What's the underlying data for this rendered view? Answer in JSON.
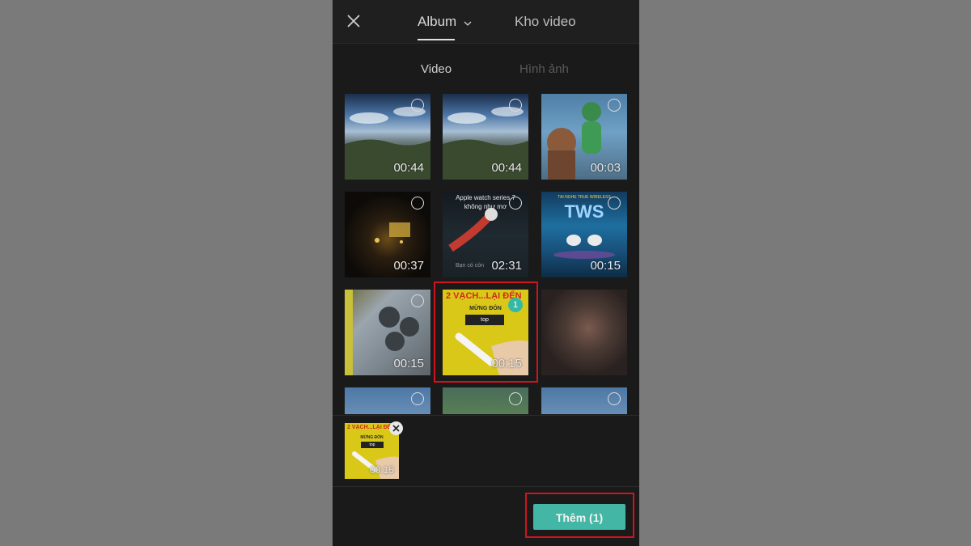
{
  "header": {
    "tabs": [
      {
        "label": "Album",
        "active": true
      },
      {
        "label": "Kho video",
        "active": false
      }
    ]
  },
  "subtabs": [
    {
      "label": "Video",
      "active": true
    },
    {
      "label": "Hình ảnh",
      "active": false
    }
  ],
  "grid": {
    "items": [
      {
        "duration": "00:44",
        "selected": false
      },
      {
        "duration": "00:44",
        "selected": false
      },
      {
        "duration": "00:03",
        "selected": false
      },
      {
        "duration": "00:37",
        "selected": false
      },
      {
        "duration": "02:31",
        "selected": false,
        "text_top": "Apple watch series 7",
        "text_mid": "không như mơ",
        "text_bottom": "Bạn có còn"
      },
      {
        "duration": "00:15",
        "selected": false,
        "text_top": "TAI NGHE TRUE WIRELESS",
        "logo": "TWS"
      },
      {
        "duration": "00:15",
        "selected": false
      },
      {
        "duration": "00:15",
        "selected": true,
        "selection_index": "1",
        "title": "2 VẠCH...LẠI ĐẾN",
        "subtitle": "MỪNG ĐÓN",
        "logo": "top"
      },
      {
        "duration": "",
        "selected": false
      },
      {
        "duration": "",
        "selected": false
      },
      {
        "duration": "",
        "selected": false
      },
      {
        "duration": "",
        "selected": false
      }
    ]
  },
  "tray": {
    "selected": [
      {
        "duration": "00:15",
        "title": "2 VẠCH...LẠI ĐẾN",
        "subtitle": "MỪNG ĐÓN",
        "logo": "top"
      }
    ]
  },
  "footer": {
    "add_label": "Thêm (1)"
  },
  "colors": {
    "accent": "#44b6a5",
    "highlight": "#d0141e",
    "background": "#1a1a1a",
    "page_backdrop": "#7a7a7a"
  },
  "icons": [
    "close-icon",
    "chevron-down-icon",
    "tray-remove-icon"
  ]
}
